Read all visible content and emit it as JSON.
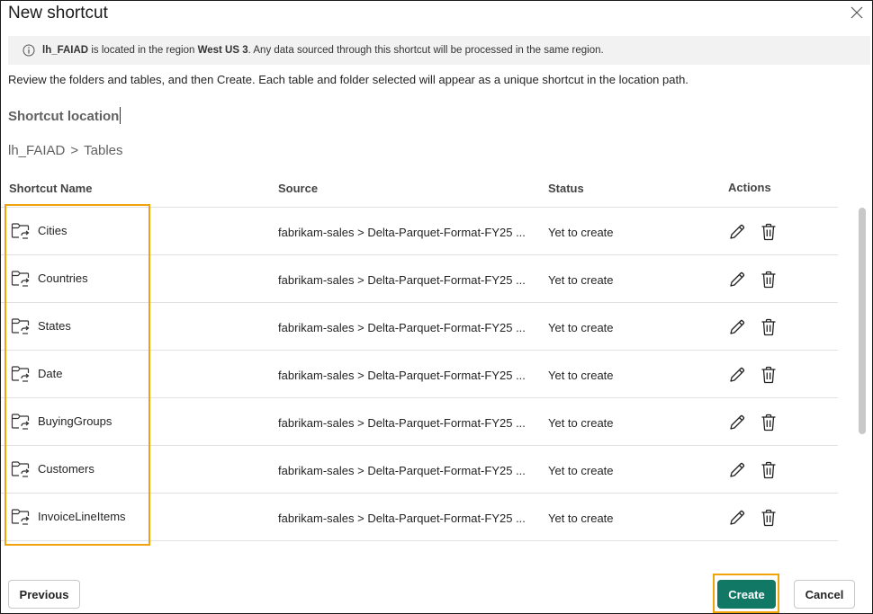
{
  "dialog": {
    "title": "New shortcut"
  },
  "info": {
    "lakehouse": "lh_FAIAD",
    "text_before_region": " is located in the region ",
    "region": "West US 3",
    "text_after": ". Any data sourced through this shortcut will be processed in the same region."
  },
  "review_text": "Review the folders and tables, and then Create. Each table and folder selected will appear as a unique shortcut in the location path.",
  "location": {
    "heading": "Shortcut location",
    "path": [
      "lh_FAIAD",
      "Tables"
    ],
    "separator": ">"
  },
  "table": {
    "headers": {
      "name": "Shortcut Name",
      "source": "Source",
      "status": "Status",
      "actions": "Actions"
    },
    "rows": [
      {
        "name": "Cities",
        "source": "fabrikam-sales > Delta-Parquet-Format-FY25 ...",
        "status": "Yet to create"
      },
      {
        "name": "Countries",
        "source": "fabrikam-sales > Delta-Parquet-Format-FY25 ...",
        "status": "Yet to create"
      },
      {
        "name": "States",
        "source": "fabrikam-sales > Delta-Parquet-Format-FY25 ...",
        "status": "Yet to create"
      },
      {
        "name": "Date",
        "source": "fabrikam-sales > Delta-Parquet-Format-FY25 ...",
        "status": "Yet to create"
      },
      {
        "name": "BuyingGroups",
        "source": "fabrikam-sales > Delta-Parquet-Format-FY25 ...",
        "status": "Yet to create"
      },
      {
        "name": "Customers",
        "source": "fabrikam-sales > Delta-Parquet-Format-FY25 ...",
        "status": "Yet to create"
      },
      {
        "name": "InvoiceLineItems",
        "source": "fabrikam-sales > Delta-Parquet-Format-FY25 ...",
        "status": "Yet to create"
      }
    ]
  },
  "footer": {
    "previous_label": "Previous",
    "create_label": "Create",
    "cancel_label": "Cancel"
  },
  "icons": {
    "row_icon": "folder-shortcut-icon",
    "edit": "pencil-icon",
    "delete": "trash-icon",
    "close": "close-icon",
    "info": "info-icon"
  },
  "colors": {
    "primary": "#117865",
    "highlight": "#f0a30a",
    "info_bg": "#f2f2f2"
  }
}
